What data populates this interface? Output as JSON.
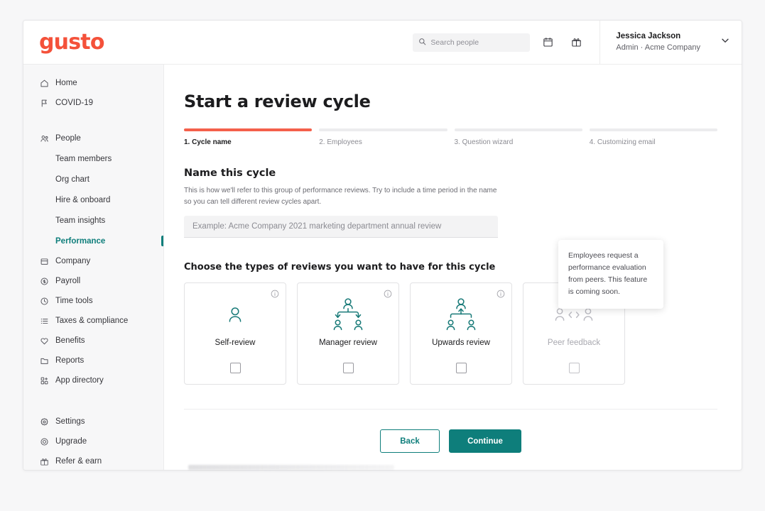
{
  "brand": {
    "logo_text": "gusto",
    "coral": "#f4513a",
    "teal": "#0e7e7b"
  },
  "header": {
    "search": {
      "placeholder": "Search people",
      "value": "",
      "icon": "search-icon"
    },
    "calendar_icon": "calendar-icon",
    "gift_icon": "gift-icon",
    "user": {
      "name": "Jessica Jackson",
      "role": "Admin · Acme Company",
      "chevron_icon": "chevron-down-icon"
    }
  },
  "sidebar": {
    "primary": [
      {
        "label": "Home",
        "icon": "home-icon"
      },
      {
        "label": "COVID-19",
        "icon": "flag-icon"
      }
    ],
    "people": {
      "label": "People",
      "icon": "people-icon"
    },
    "people_sub": [
      {
        "label": "Team members",
        "active": false
      },
      {
        "label": "Org chart",
        "active": false
      },
      {
        "label": "Hire & onboard",
        "active": false
      },
      {
        "label": "Team insights",
        "active": false
      },
      {
        "label": "Performance",
        "active": true
      }
    ],
    "secondary": [
      {
        "label": "Company",
        "icon": "building-icon"
      },
      {
        "label": "Payroll",
        "icon": "dollar-icon"
      },
      {
        "label": "Time tools",
        "icon": "clock-icon"
      },
      {
        "label": "Taxes & compliance",
        "icon": "list-icon"
      },
      {
        "label": "Benefits",
        "icon": "heart-icon"
      },
      {
        "label": "Reports",
        "icon": "folder-icon"
      },
      {
        "label": "App directory",
        "icon": "grid-icon"
      }
    ],
    "footer": [
      {
        "label": "Settings",
        "icon": "gear-icon"
      },
      {
        "label": "Upgrade",
        "icon": "upgrade-icon"
      },
      {
        "label": "Refer & earn",
        "icon": "gift-icon"
      }
    ]
  },
  "main": {
    "title": "Start a review cycle",
    "steps": [
      {
        "label": "1. Cycle name",
        "done": true
      },
      {
        "label": "2. Employees",
        "done": false
      },
      {
        "label": "3. Question wizard",
        "done": false
      },
      {
        "label": "4. Customizing email",
        "done": false
      }
    ],
    "name_section": {
      "title": "Name this cycle",
      "description": "This is how we'll refer to this group of performance reviews. Try to include a time period in the name so you can tell different review cycles apart.",
      "input_placeholder": "Example: Acme Company 2021 marketing department annual review",
      "input_value": ""
    },
    "tooltip": {
      "text": "Employees request a performance evaluation from peers. This feature is coming soon."
    },
    "choose_title": "Choose the types of reviews you want to have for this cycle",
    "review_cards": [
      {
        "label": "Self-review",
        "art": "self-review-icon",
        "info_icon": "info-icon",
        "checked": false,
        "disabled": false
      },
      {
        "label": "Manager review",
        "art": "manager-review-icon",
        "info_icon": "info-icon",
        "checked": false,
        "disabled": false
      },
      {
        "label": "Upwards review",
        "art": "upwards-review-icon",
        "info_icon": "info-icon",
        "checked": false,
        "disabled": false
      },
      {
        "label": "Peer feedback",
        "art": "peer-feedback-icon",
        "info_icon": "info-icon",
        "checked": false,
        "disabled": true
      }
    ],
    "actions": {
      "back_label": "Back",
      "continue_label": "Continue"
    }
  }
}
